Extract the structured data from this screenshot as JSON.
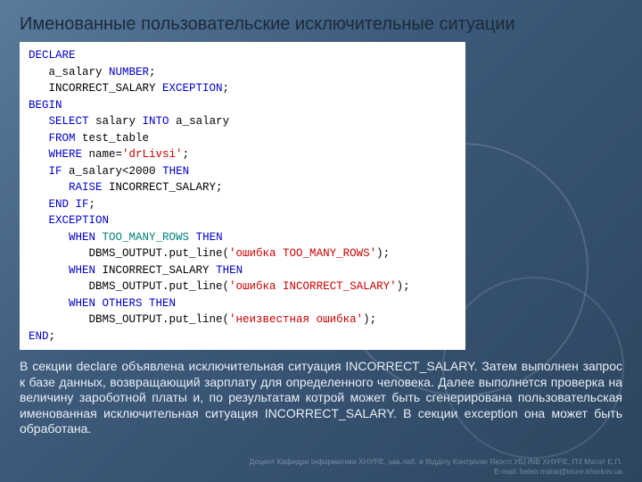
{
  "title": "Именованные пользовательские исключительные ситуации",
  "code": {
    "l1": "DECLARE",
    "l2a": "   a_salary ",
    "l2b": "NUMBER",
    "l2c": ";",
    "l3a": "   INCORRECT_SALARY ",
    "l3b": "EXCEPTION",
    "l3c": ";",
    "l4": "BEGIN",
    "l5a": "   ",
    "l5b": "SELECT",
    "l5c": " salary ",
    "l5d": "INTO",
    "l5e": " a_salary",
    "l6a": "   ",
    "l6b": "FROM",
    "l6c": " test_table",
    "l7a": "   ",
    "l7b": "WHERE",
    "l7c": " name=",
    "l7d": "'drLivsi'",
    "l7e": ";",
    "l8a": "   ",
    "l8b": "IF",
    "l8c": " a_salary<2000 ",
    "l8d": "THEN",
    "l9a": "      ",
    "l9b": "RAISE",
    "l9c": " INCORRECT_SALARY;",
    "l10a": "   ",
    "l10b": "END IF",
    "l10c": ";",
    "l11a": "   ",
    "l11b": "EXCEPTION",
    "l12a": "      ",
    "l12b": "WHEN",
    "l12c": " TOO_MANY_ROWS ",
    "l12d": "THEN",
    "l13a": "         DBMS_OUTPUT.put_line(",
    "l13b": "'ошибка TOO_MANY_ROWS'",
    "l13c": ");",
    "l14a": "      ",
    "l14b": "WHEN",
    "l14c": " INCORRECT_SALARY ",
    "l14d": "THEN",
    "l15a": "         DBMS_OUTPUT.put_line(",
    "l15b": "'ошибка INCORRECT_SALARY'",
    "l15c": ");",
    "l16a": "      ",
    "l16b": "WHEN OTHERS THEN",
    "l17a": "         DBMS_OUTPUT.put_line(",
    "l17b": "'неизвестная ошибка'",
    "l17c": ");",
    "l18a": "END",
    "l18b": ";"
  },
  "paragraph": "В секции declare объявлена исключительная ситуация INCORRECT_SALARY. Затем выполнен запрос к базе данных, возвращающий зарплату для определенного человека. Далее выполнется проверка на величину зароботной платы и, по результатам котрой может быть сгенерирована пользовательская именованная исключительная ситуация INCORRECT_SALARY. В секции exception она может быть обработана.",
  "footer1": "Доцент Кафедри Інформатики ХНУРЕ, зав.лаб. в Відділу Контролю Якості УБ| INB ХНУРЕ, ПЗ Матат Е.П.",
  "footer2": "E-mail: helen.matat@kture.kharkov.ua"
}
